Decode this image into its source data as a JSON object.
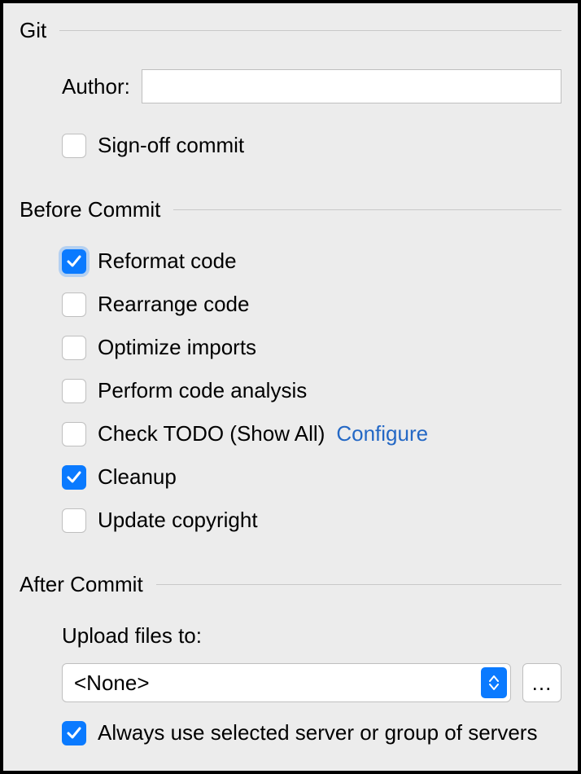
{
  "git": {
    "title": "Git",
    "author_label": "Author:",
    "author_value": "",
    "signoff": {
      "label": "Sign-off commit",
      "checked": false
    }
  },
  "before": {
    "title": "Before Commit",
    "items": [
      {
        "label": "Reformat code",
        "checked": true,
        "halo": true
      },
      {
        "label": "Rearrange code",
        "checked": false
      },
      {
        "label": "Optimize imports",
        "checked": false
      },
      {
        "label": "Perform code analysis",
        "checked": false
      },
      {
        "label": "Check TODO (Show All)",
        "checked": false,
        "link": "Configure"
      },
      {
        "label": "Cleanup",
        "checked": true
      },
      {
        "label": "Update copyright",
        "checked": false
      }
    ]
  },
  "after": {
    "title": "After Commit",
    "upload_label": "Upload files to:",
    "upload_value": "<None>",
    "more_label": "...",
    "always_use": {
      "label": "Always use selected server or group of servers",
      "checked": true
    }
  }
}
